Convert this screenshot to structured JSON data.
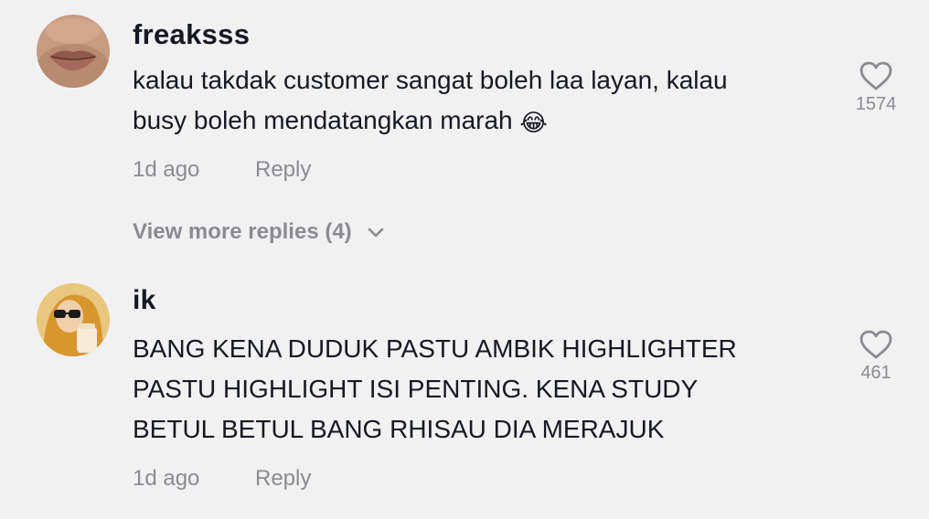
{
  "comments": [
    {
      "username": "freaksss",
      "text_line1": "kalau takdak customer sangat boleh laa layan, kalau",
      "text_line2": "busy boleh mendatangkan marah",
      "emoji": "😂",
      "time": "1d ago",
      "reply_label": "Reply",
      "likes": "1574",
      "avatar_icon": "lips-avatar"
    },
    {
      "username": "ik",
      "text_line1": "BANG KENA DUDUK PASTU AMBIK HIGHLIGHTER",
      "text_line2": "PASTU HIGHLIGHT ISI PENTING. KENA STUDY",
      "text_line3": "BETUL BETUL BANG RHISAU DIA MERAJUK",
      "time": "1d ago",
      "reply_label": "Reply",
      "likes": "461",
      "avatar_icon": "person-with-sunglasses-avatar"
    }
  ],
  "view_more_replies": "View more replies (4)",
  "icons": {
    "like": "heart-outline-icon",
    "expand": "chevron-down-icon"
  },
  "colors": {
    "background": "#f1f1f2",
    "text": "#161823",
    "muted": "#8a8b91"
  }
}
